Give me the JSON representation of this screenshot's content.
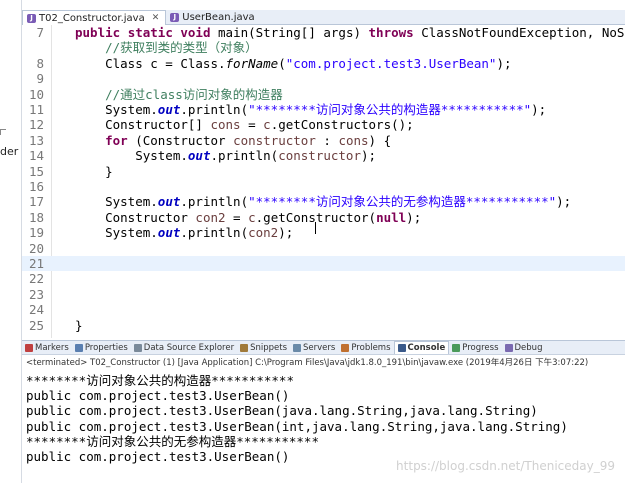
{
  "editor_tabs": [
    {
      "label": "T02_Constructor.java",
      "active": true
    },
    {
      "label": "UserBean.java",
      "active": false
    }
  ],
  "left_panel": {
    "partial_label": "der"
  },
  "code_lines": [
    {
      "num": "7",
      "tokens": [
        [
          "kw",
          "public "
        ],
        [
          "kw",
          "static "
        ],
        [
          "kw",
          "void "
        ],
        [
          "",
          "main(String[] args) "
        ],
        [
          "kw",
          "throws "
        ],
        [
          "",
          "ClassNotFoundException, NoSuchMe"
        ]
      ]
    },
    {
      "num": "",
      "tokens": [
        [
          "",
          "    "
        ],
        [
          "cmt",
          "//获取到类的类型（对象）"
        ]
      ]
    },
    {
      "num": "8",
      "tokens": [
        [
          "",
          "    Class c = Class."
        ],
        [
          "static",
          "forName"
        ],
        [
          "",
          "("
        ],
        [
          "str",
          "\"com.project.test3.UserBean\""
        ],
        [
          "",
          ");"
        ]
      ]
    },
    {
      "num": "9",
      "tokens": []
    },
    {
      "num": "10",
      "tokens": [
        [
          "",
          "    "
        ],
        [
          "cmt",
          "//通过class访问对象的构造器"
        ]
      ]
    },
    {
      "num": "11",
      "tokens": [
        [
          "",
          "    System."
        ],
        [
          "fld",
          "out"
        ],
        [
          "",
          ".println("
        ],
        [
          "str",
          "\"********访问对象公共的构造器***********\""
        ],
        [
          "",
          ");"
        ]
      ]
    },
    {
      "num": "12",
      "tokens": [
        [
          "",
          "    Constructor[] "
        ],
        [
          "var",
          "cons"
        ],
        [
          "",
          " = "
        ],
        [
          "var",
          "c"
        ],
        [
          "",
          ".getConstructors();"
        ]
      ]
    },
    {
      "num": "13",
      "tokens": [
        [
          "",
          "    "
        ],
        [
          "kw",
          "for "
        ],
        [
          "",
          "(Constructor "
        ],
        [
          "var",
          "constructor"
        ],
        [
          "",
          " : "
        ],
        [
          "var",
          "cons"
        ],
        [
          "",
          ") {"
        ]
      ]
    },
    {
      "num": "14",
      "tokens": [
        [
          "",
          "        System."
        ],
        [
          "fld",
          "out"
        ],
        [
          "",
          ".println("
        ],
        [
          "var",
          "constructor"
        ],
        [
          "",
          ");"
        ]
      ]
    },
    {
      "num": "15",
      "tokens": [
        [
          "",
          "    }"
        ]
      ]
    },
    {
      "num": "16",
      "tokens": []
    },
    {
      "num": "17",
      "tokens": [
        [
          "",
          "    System."
        ],
        [
          "fld",
          "out"
        ],
        [
          "",
          ".println("
        ],
        [
          "str",
          "\"********访问对象公共的无参构造器***********\""
        ],
        [
          "",
          ");"
        ]
      ]
    },
    {
      "num": "18",
      "tokens": [
        [
          "",
          "    Constructor "
        ],
        [
          "var",
          "con2"
        ],
        [
          "",
          " = "
        ],
        [
          "var",
          "c"
        ],
        [
          "",
          ".getConstructor("
        ],
        [
          "kw",
          "null"
        ],
        [
          "",
          ");"
        ]
      ]
    },
    {
      "num": "19",
      "tokens": [
        [
          "",
          "    System."
        ],
        [
          "fld",
          "out"
        ],
        [
          "",
          ".println("
        ],
        [
          "var",
          "con2"
        ],
        [
          "",
          ");"
        ]
      ]
    },
    {
      "num": "20",
      "tokens": []
    },
    {
      "num": "21",
      "tokens": [],
      "current": true
    },
    {
      "num": "22",
      "tokens": []
    },
    {
      "num": "23",
      "tokens": []
    },
    {
      "num": "24",
      "tokens": []
    },
    {
      "num": "25",
      "tokens": [
        [
          "",
          "}"
        ]
      ]
    }
  ],
  "views_tabs": [
    {
      "label": "Markers",
      "color": "#c04040",
      "active": false
    },
    {
      "label": "Properties",
      "color": "#5a7fb0",
      "active": false
    },
    {
      "label": "Data Source Explorer",
      "color": "#7a8a9a",
      "active": false
    },
    {
      "label": "Snippets",
      "color": "#a07a3a",
      "active": false
    },
    {
      "label": "Servers",
      "color": "#6a8aa8",
      "active": false
    },
    {
      "label": "Problems",
      "color": "#c07030",
      "active": false
    },
    {
      "label": "Console",
      "color": "#3a5a8a",
      "active": true
    },
    {
      "label": "Progress",
      "color": "#4a9a5a",
      "active": false
    },
    {
      "label": "Debug",
      "color": "#7a6ab0",
      "active": false
    }
  ],
  "console": {
    "header": "<terminated> T02_Constructor (1) [Java Application] C:\\Program Files\\Java\\jdk1.8.0_191\\bin\\javaw.exe (2019年4月26日 下午3:07:22)",
    "lines": [
      "********访问对象公共的构造器***********",
      "public com.project.test3.UserBean()",
      "public com.project.test3.UserBean(java.lang.String,java.lang.String)",
      "public com.project.test3.UserBean(int,java.lang.String,java.lang.String)",
      "********访问对象公共的无参构造器***********",
      "public com.project.test3.UserBean()"
    ]
  },
  "watermark": "https://blog.csdn.net/Theniceday_99"
}
